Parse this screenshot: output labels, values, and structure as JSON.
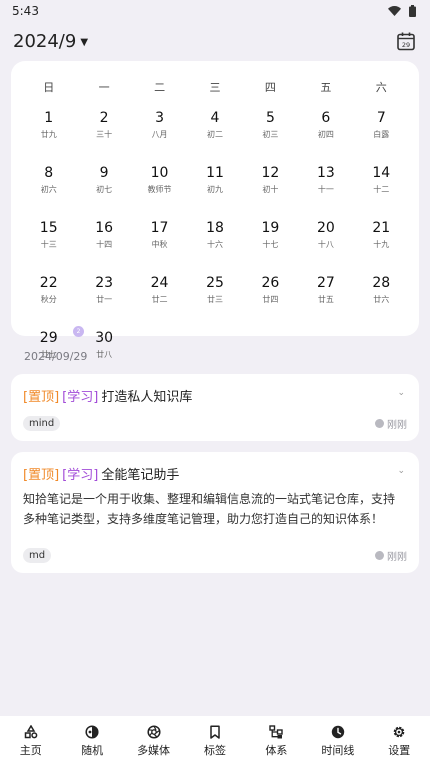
{
  "status": {
    "time": "5:43"
  },
  "header": {
    "month": "2024/9",
    "calendar_icon_day": "29"
  },
  "calendar": {
    "weekdays": [
      "日",
      "一",
      "二",
      "三",
      "四",
      "五",
      "六"
    ],
    "weeks": [
      [
        {
          "d": "1",
          "l": "廿九"
        },
        {
          "d": "2",
          "l": "三十"
        },
        {
          "d": "3",
          "l": "八月"
        },
        {
          "d": "4",
          "l": "初二"
        },
        {
          "d": "5",
          "l": "初三"
        },
        {
          "d": "6",
          "l": "初四"
        },
        {
          "d": "7",
          "l": "白露"
        }
      ],
      [
        {
          "d": "8",
          "l": "初六"
        },
        {
          "d": "9",
          "l": "初七"
        },
        {
          "d": "10",
          "l": "教师节"
        },
        {
          "d": "11",
          "l": "初九"
        },
        {
          "d": "12",
          "l": "初十"
        },
        {
          "d": "13",
          "l": "十一"
        },
        {
          "d": "14",
          "l": "十二"
        }
      ],
      [
        {
          "d": "15",
          "l": "十三"
        },
        {
          "d": "16",
          "l": "十四"
        },
        {
          "d": "17",
          "l": "中秋"
        },
        {
          "d": "18",
          "l": "十六"
        },
        {
          "d": "19",
          "l": "十七"
        },
        {
          "d": "20",
          "l": "十八"
        },
        {
          "d": "21",
          "l": "十九"
        }
      ],
      [
        {
          "d": "22",
          "l": "秋分"
        },
        {
          "d": "23",
          "l": "廿一"
        },
        {
          "d": "24",
          "l": "廿二"
        },
        {
          "d": "25",
          "l": "廿三"
        },
        {
          "d": "26",
          "l": "廿四"
        },
        {
          "d": "27",
          "l": "廿五"
        },
        {
          "d": "28",
          "l": "廿六"
        }
      ],
      [
        {
          "d": "29",
          "l": "廿七",
          "badge": "2"
        },
        {
          "d": "30",
          "l": "廿八"
        }
      ]
    ]
  },
  "selected_date": "2024/09/29",
  "notes": [
    {
      "pin": "[置顶]",
      "category": "[学习]",
      "title": "打造私人知识库",
      "body": "",
      "tag": "mind",
      "time": "刚刚"
    },
    {
      "pin": "[置顶]",
      "category": "[学习]",
      "title": "全能笔记助手",
      "body": "知拾笔记是一个用于收集、整理和编辑信息流的一站式笔记仓库，支持多种笔记类型，支持多维度笔记管理，助力您打造自己的知识体系！",
      "tag": "md",
      "time": "刚刚"
    }
  ],
  "nav": [
    {
      "label": "主页",
      "icon": "shapes-icon"
    },
    {
      "label": "随机",
      "icon": "shuffle-icon"
    },
    {
      "label": "多媒体",
      "icon": "aperture-icon"
    },
    {
      "label": "标签",
      "icon": "bookmark-icon"
    },
    {
      "label": "体系",
      "icon": "hierarchy-icon"
    },
    {
      "label": "时间线",
      "icon": "clock-icon"
    },
    {
      "label": "设置",
      "icon": "gear-icon"
    }
  ],
  "colors": {
    "pin": "#f08a2a",
    "category": "#a24cd8",
    "background": "#f1eff5",
    "badge": "#c9b7f1"
  }
}
